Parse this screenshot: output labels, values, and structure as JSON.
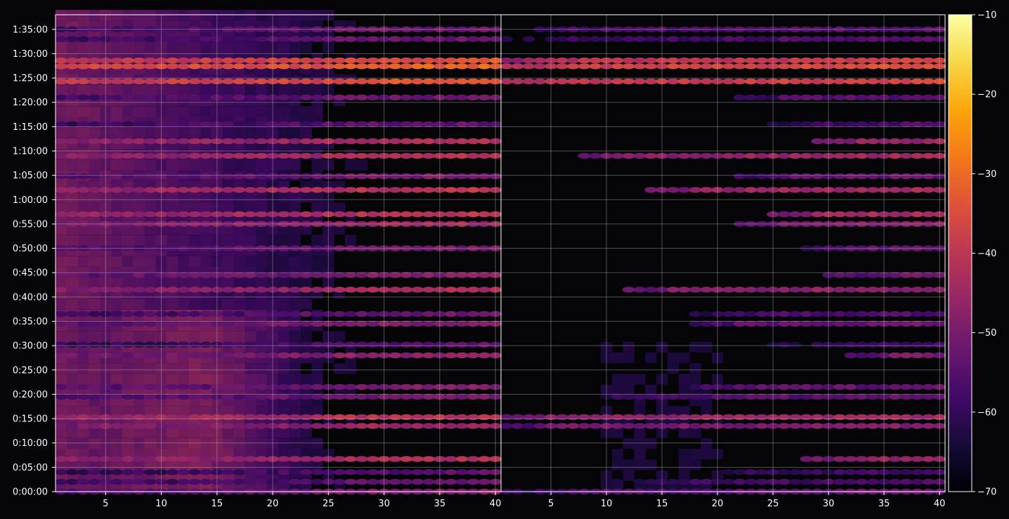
{
  "chart_data": {
    "type": "heatmap",
    "title": "",
    "xlabel": "",
    "ylabel": "",
    "colormap": "inferno",
    "background": "#050507",
    "grid": true,
    "panels": [
      {
        "name": "",
        "x_range": [
          1,
          40
        ],
        "x_ticks": [
          5,
          10,
          15,
          20,
          25,
          30,
          35,
          40
        ]
      },
      {
        "name": "",
        "x_range": [
          1,
          40
        ],
        "x_ticks": [
          5,
          10,
          15,
          20,
          25,
          30,
          35,
          40
        ]
      }
    ],
    "y_range_seconds": [
      0,
      5880
    ],
    "y_tick_labels": [
      "0:00:00",
      "0:05:00",
      "0:10:00",
      "0:15:00",
      "0:20:00",
      "0:25:00",
      "0:30:00",
      "0:35:00",
      "0:40:00",
      "0:45:00",
      "0:50:00",
      "0:55:00",
      "1:00:00",
      "1:05:00",
      "1:10:00",
      "1:15:00",
      "1:20:00",
      "1:25:00",
      "1:30:00",
      "1:35:00"
    ],
    "colorbar": {
      "range": [
        -70,
        -10
      ],
      "tick_labels": [
        "−10",
        "−20",
        "−30",
        "−40",
        "−50",
        "−60",
        "−70"
      ],
      "tick_values": [
        -10,
        -20,
        -30,
        -40,
        -50,
        -60,
        -70
      ]
    },
    "bands_minutes": [
      {
        "t": 0,
        "level": -53,
        "onset": 1
      },
      {
        "t": 2,
        "level": -57,
        "onset": 10
      },
      {
        "t": 4,
        "level": -58,
        "onset": 18
      },
      {
        "t": 6.7,
        "level": -46,
        "onset": 28
      },
      {
        "t": 13.5,
        "level": -48,
        "onset": 1
      },
      {
        "t": 15.3,
        "level": -44,
        "onset": 1
      },
      {
        "t": 19.5,
        "level": -54,
        "onset": 10
      },
      {
        "t": 21.5,
        "level": -53,
        "onset": 18
      },
      {
        "t": 28,
        "level": -50,
        "onset": 32
      },
      {
        "t": 30.2,
        "level": -58,
        "onset": 25
      },
      {
        "t": 34.5,
        "level": -52,
        "onset": 18
      },
      {
        "t": 36.5,
        "level": -56,
        "onset": 18
      },
      {
        "t": 41.5,
        "level": -47,
        "onset": 12
      },
      {
        "t": 44.5,
        "level": -52,
        "onset": 30
      },
      {
        "t": 50,
        "level": -54,
        "onset": 28
      },
      {
        "t": 55,
        "level": -48,
        "onset": 22
      },
      {
        "t": 57,
        "level": -44,
        "onset": 25
      },
      {
        "t": 62,
        "level": -44,
        "onset": 14
      },
      {
        "t": 64.8,
        "level": -53,
        "onset": 22
      },
      {
        "t": 69,
        "level": -45,
        "onset": 8
      },
      {
        "t": 72,
        "level": -46,
        "onset": 29
      },
      {
        "t": 75.5,
        "level": -57,
        "onset": 25
      },
      {
        "t": 81,
        "level": -55,
        "onset": 22
      },
      {
        "t": 84.3,
        "level": -37,
        "onset": 1
      },
      {
        "t": 87.4,
        "level": -35,
        "onset": 1
      },
      {
        "t": 88.6,
        "level": -38,
        "onset": 1
      },
      {
        "t": 93,
        "level": -56,
        "onset": 1
      },
      {
        "t": 95,
        "level": -55,
        "onset": 1
      }
    ]
  }
}
